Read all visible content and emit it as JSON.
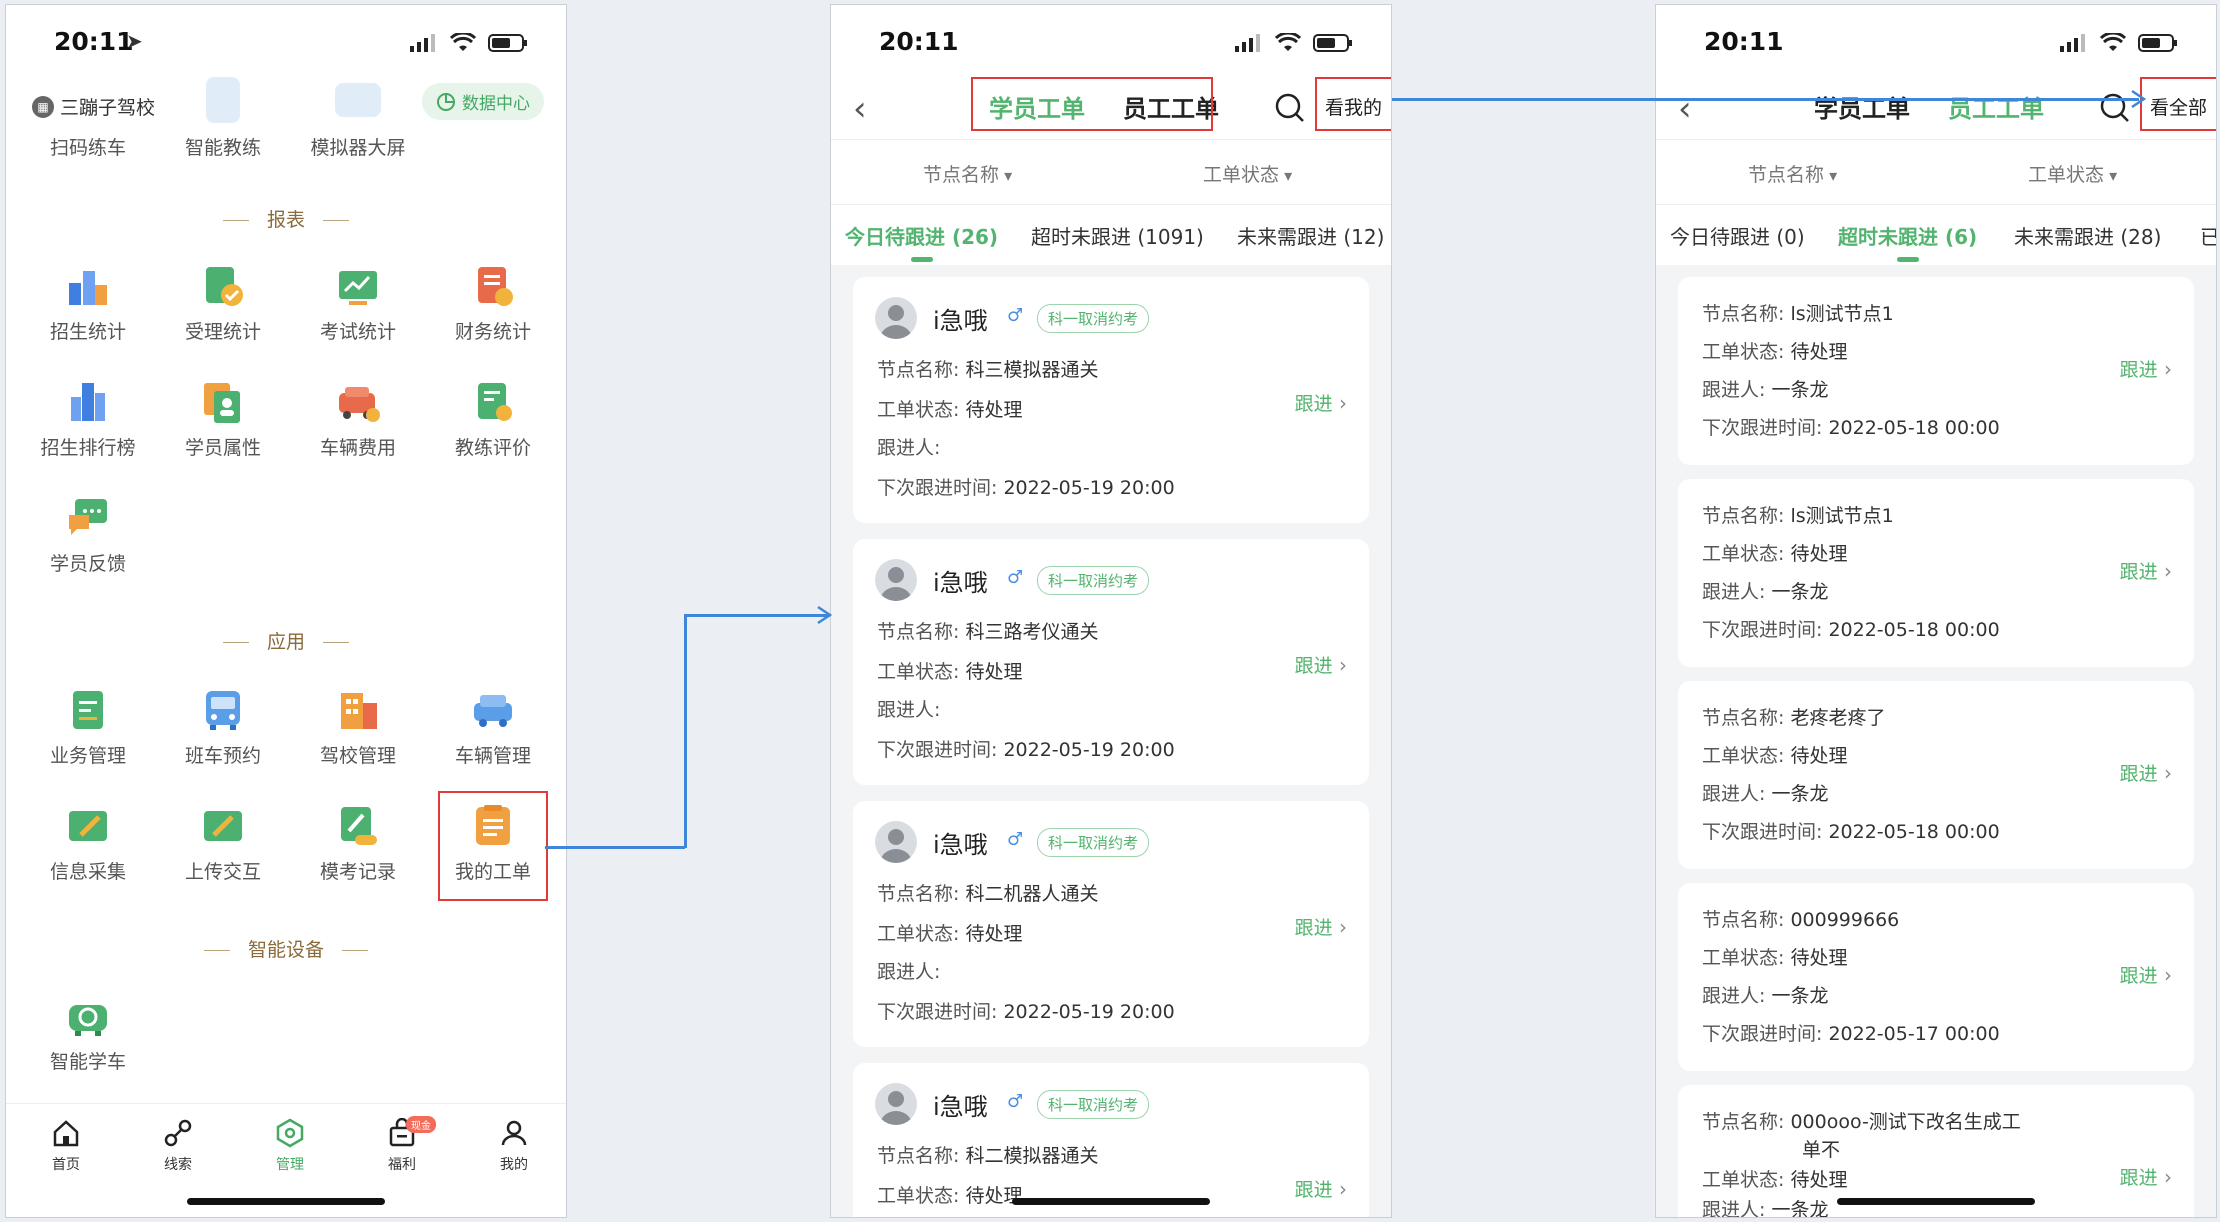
{
  "phone1": {
    "status_time": "20:11",
    "school_name": "三蹦子驾校",
    "data_center": "数据中心",
    "top_shortcuts": [
      {
        "label": "扫码练车",
        "icon": "scan-car-icon"
      },
      {
        "label": "智能教练",
        "icon": "smart-coach-icon"
      },
      {
        "label": "模拟器大屏",
        "icon": "simulator-screen-icon"
      }
    ],
    "section_report": "报表",
    "reports": [
      {
        "label": "招生统计",
        "icon": "enroll-stats-icon"
      },
      {
        "label": "受理统计",
        "icon": "accept-stats-icon"
      },
      {
        "label": "考试统计",
        "icon": "exam-stats-icon"
      },
      {
        "label": "财务统计",
        "icon": "finance-stats-icon"
      },
      {
        "label": "招生排行榜",
        "icon": "enroll-rank-icon"
      },
      {
        "label": "学员属性",
        "icon": "student-attr-icon"
      },
      {
        "label": "车辆费用",
        "icon": "vehicle-cost-icon"
      },
      {
        "label": "教练评价",
        "icon": "coach-rating-icon"
      },
      {
        "label": "学员反馈",
        "icon": "student-feedback-icon"
      }
    ],
    "section_app": "应用",
    "apps": [
      {
        "label": "业务管理",
        "icon": "business-icon"
      },
      {
        "label": "班车预约",
        "icon": "shuttle-icon"
      },
      {
        "label": "驾校管理",
        "icon": "school-manage-icon"
      },
      {
        "label": "车辆管理",
        "icon": "vehicle-manage-icon"
      },
      {
        "label": "信息采集",
        "icon": "info-collect-icon"
      },
      {
        "label": "上传交互",
        "icon": "upload-icon"
      },
      {
        "label": "模考记录",
        "icon": "mock-exam-icon"
      },
      {
        "label": "我的工单",
        "icon": "my-workorder-icon"
      }
    ],
    "section_device": "智能设备",
    "devices": [
      {
        "label": "智能学车",
        "icon": "smart-car-icon"
      }
    ],
    "tabbar": [
      {
        "label": "首页",
        "icon": "home-icon"
      },
      {
        "label": "线索",
        "icon": "clue-icon"
      },
      {
        "label": "管理",
        "icon": "manage-icon"
      },
      {
        "label": "福利",
        "icon": "welfare-icon",
        "badge": "现金"
      },
      {
        "label": "我的",
        "icon": "profile-icon"
      }
    ]
  },
  "phone2": {
    "status_time": "20:11",
    "seg_student": "学员工单",
    "seg_staff": "员工工单",
    "view_btn": "看我的",
    "filter_node": "节点名称",
    "filter_status": "工单状态",
    "subtabs": [
      "今日待跟进 (26)",
      "超时未跟进 (1091)",
      "未来需跟进 (12)"
    ],
    "labels": {
      "node": "节点名称:",
      "status": "工单状态:",
      "follower": "跟进人:",
      "next": "下次跟进时间:",
      "follow": "跟进"
    },
    "cards": [
      {
        "name": "i急哦",
        "gender": "♂",
        "tag": "科一取消约考",
        "node": "科三模拟器通关",
        "status": "待处理",
        "follower": "",
        "next": "2022-05-19 20:00"
      },
      {
        "name": "i急哦",
        "gender": "♂",
        "tag": "科一取消约考",
        "node": "科三路考仪通关",
        "status": "待处理",
        "follower": "",
        "next": "2022-05-19 20:00"
      },
      {
        "name": "i急哦",
        "gender": "♂",
        "tag": "科一取消约考",
        "node": "科二机器人通关",
        "status": "待处理",
        "follower": "",
        "next": "2022-05-19 20:00"
      },
      {
        "name": "i急哦",
        "gender": "♂",
        "tag": "科一取消约考",
        "node": "科二模拟器通关",
        "status": "待处理",
        "follower": "",
        "next": ""
      }
    ]
  },
  "phone3": {
    "status_time": "20:11",
    "seg_student": "学员工单",
    "seg_staff": "员工工单",
    "view_btn": "看全部",
    "filter_node": "节点名称",
    "filter_status": "工单状态",
    "subtabs": [
      "今日待跟进 (0)",
      "超时未跟进 (6)",
      "未来需跟进 (28)",
      "已"
    ],
    "labels": {
      "node": "节点名称:",
      "status": "工单状态:",
      "follower": "跟进人:",
      "next": "下次跟进时间:",
      "follow": "跟进"
    },
    "cards": [
      {
        "node": "ls测试节点1",
        "status": "待处理",
        "follower": "一条龙",
        "next": "2022-05-18 00:00"
      },
      {
        "node": "ls测试节点1",
        "status": "待处理",
        "follower": "一条龙",
        "next": "2022-05-18 00:00"
      },
      {
        "node": "老疼老疼了",
        "status": "待处理",
        "follower": "一条龙",
        "next": "2022-05-18 00:00"
      },
      {
        "node": "000999666",
        "status": "待处理",
        "follower": "一条龙",
        "next": "2022-05-17 00:00"
      },
      {
        "node": "000ooo-测试下改名生成工",
        "node_line2": "单不",
        "status": "待处理",
        "follower": "一条龙",
        "next": ""
      }
    ]
  },
  "colors": {
    "accent": "#52b46e",
    "highlight_box": "#e23a3a",
    "arrow": "#3e86d8",
    "section": "#8a6b3a"
  }
}
